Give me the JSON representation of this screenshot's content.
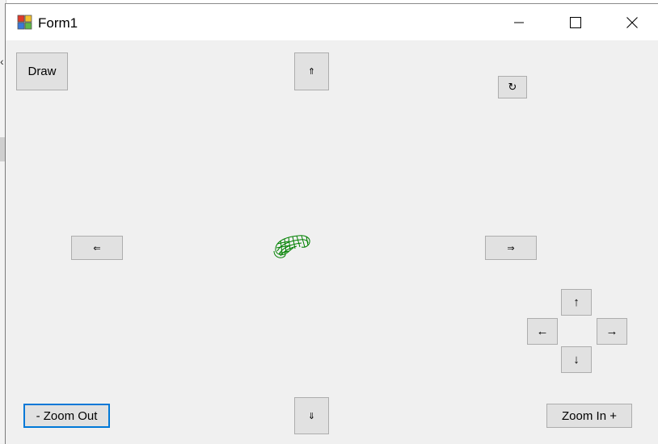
{
  "window": {
    "title": "Form1",
    "controls": [
      "minimize-icon",
      "maximize-icon",
      "close-icon"
    ]
  },
  "buttons": {
    "draw": "Draw",
    "move_up": "⇑",
    "rotate": "↻",
    "move_left": "⇐",
    "move_right": "⇒",
    "move_down": "⇓",
    "nudge_up": "↑",
    "nudge_left": "←",
    "nudge_right": "→",
    "nudge_down": "↓",
    "zoom_out": "- Zoom Out",
    "zoom_in": "Zoom In +"
  },
  "colors": {
    "shape_stroke": "#008000",
    "focus_border": "#0078d7"
  }
}
